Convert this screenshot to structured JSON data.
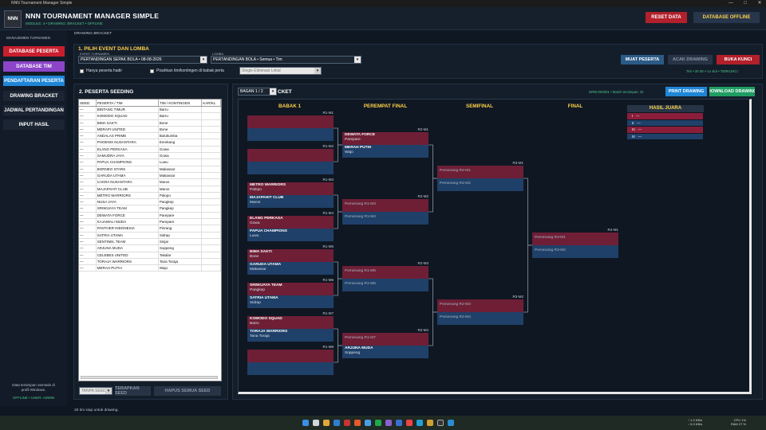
{
  "window": {
    "title": "NNN Tournament Manager Simple",
    "min": "—",
    "max": "□",
    "close": "✕"
  },
  "app": {
    "logo": "NNN",
    "title": "NNN TOURNAMENT MANAGER SIMPLE",
    "subtitle": "MODULE: 4 • DRAWING: BRACKET • OFFLINE",
    "reset_label": "RESET DATA",
    "db_label": "DATABASE OFFLINE"
  },
  "sidebar": {
    "heading": "MANAJEMEN TURNAMEN",
    "items": [
      {
        "label": "DATABASE PESERTA",
        "color": "#c81f2e"
      },
      {
        "label": "DATABASE TIM",
        "color": "#8c45c8"
      },
      {
        "label": "PENDAFTARAN PESERTA",
        "color": "#1f86d6"
      },
      {
        "label": "DRAWING  BRACKET",
        "color": "#1c2533"
      },
      {
        "label": "JADWAL PERTANDINGAN",
        "color": "#1c2533"
      },
      {
        "label": "INPUT HASIL",
        "color": "#1c2533"
      }
    ],
    "footer_line1": "Data tersimpan otomatis di",
    "footer_line2": "profil Windows.",
    "footer_status": "OFFLINE • USER: ADMIN"
  },
  "breadcrumb": "DRAWING  BRACKET",
  "event_panel": {
    "title": "1. PILIH EVENT DAN LOMBA",
    "event_label": "EVENT TURNAMEN",
    "event_value": "PERTANDINGAN SEPAK BOLA • 08-08-2026",
    "lomba_label": "LOMBA",
    "lomba_value": "PERTANDINGAN BOLA • Semua • Tim",
    "chk_hadir": "Hanya peserta hadir",
    "chk_pisahkan": "Pisahkan tim/kontingen di babak perta",
    "mode_value": "Single Eliminasi Lokal",
    "btn_muat": "MUAT PESERTA",
    "btn_acak": "ACAK DRAWING",
    "btn_kunci": "BUKA KUNCI",
    "info": "Tim • 25 tim • 1x slot • TERKUNCI"
  },
  "seeding": {
    "title": "2. PESERTA   SEEDING",
    "headers": [
      "SEED",
      "PESERTA / TIM",
      "TIM / KONTINGEN",
      "KAR/KL"
    ],
    "rows": [
      [
        "—",
        "BINTANG TIMUR",
        "Barru"
      ],
      [
        "—",
        "KOMODO SQUAD",
        "Barru"
      ],
      [
        "—",
        "BIMA SAKTI",
        "Bone"
      ],
      [
        "—",
        "MERAPI UNITED",
        "Bone"
      ],
      [
        "—",
        "ANDALAS PRIME",
        "Bulukumba"
      ],
      [
        "—",
        "PHOENIX NUSANTARA",
        "Enrekang"
      ],
      [
        "—",
        "ELANG PERKASA",
        "Gowa"
      ],
      [
        "—",
        "SAMUDRA JAYA",
        "Gowa"
      ],
      [
        "—",
        "PAPUA CHAMPIONS",
        "Luwu"
      ],
      [
        "—",
        "BORNEO STARS",
        "Makassar"
      ],
      [
        "—",
        "GARUDA UTAMA",
        "Makassar"
      ],
      [
        "—",
        "CAKRA NUSANTARA",
        "Maros"
      ],
      [
        "—",
        "MAJAPAHIT CLUB",
        "Maros"
      ],
      [
        "—",
        "METRO WARRIORS",
        "Palopo"
      ],
      [
        "—",
        "NUSA JAYA",
        "Pangkep"
      ],
      [
        "—",
        "SRIWIJAYA TEAM",
        "Pangkep"
      ],
      [
        "—",
        "DEWATA FORCE",
        "Parepare"
      ],
      [
        "—",
        "KAJAWALI MUDA",
        "Parepare"
      ],
      [
        "—",
        "PANTHER INDONESIA",
        "Pinrang"
      ],
      [
        "—",
        "SATRIA UTAMA",
        "Sidrap"
      ],
      [
        "—",
        "SENTINEL TEAM",
        "Sinjai"
      ],
      [
        "—",
        "ARJUNA MUDA",
        "Soppeng"
      ],
      [
        "—",
        "CELEBES UNITED",
        "Takalar"
      ],
      [
        "—",
        "TORAJA WARRIORS",
        "Tana Toraja"
      ],
      [
        "—",
        "MERAH PUTIH",
        "Wajo"
      ]
    ],
    "seed_select": "TANPA SEED",
    "btn_terapkan": "TERAPKAN SEED",
    "btn_hapus": "HAPUS SEMUA SEED"
  },
  "bracket": {
    "page_select": "BAGAN 1 / 2",
    "title_tail": "CKET",
    "info": "DRW-000001 • Match tersimpan: 31",
    "btn_print": "PRINT DRAWING",
    "btn_download": "DOWNLOAD DRAWING",
    "btn_terkunci": "DRAWING TERKUNCI",
    "rounds": [
      "BABAK 1",
      "PEREMPAT FINAL",
      "SEMIFINAL",
      "FINAL"
    ],
    "r1": [
      {
        "id": "R1-M1",
        "a": "",
        "ac": "",
        "b": "",
        "bc": ""
      },
      {
        "id": "R1-M2",
        "a": "",
        "ac": "",
        "b": "",
        "bc": ""
      },
      {
        "id": "R1-M3",
        "a": "METRO WARRIORS",
        "ac": "Palopo",
        "b": "MAJAPAHIT CLUB",
        "bc": "Maros"
      },
      {
        "id": "R1-M4",
        "a": "ELANG PERKASA",
        "ac": "Gowa",
        "b": "PAPUA CHAMPIONS",
        "bc": "Luwu"
      },
      {
        "id": "R1-M5",
        "a": "BIMA SAKTI",
        "ac": "Bone",
        "b": "GARUDA UTAMA",
        "bc": "Makassar"
      },
      {
        "id": "R1-M6",
        "a": "SRIWIJAYA TEAM",
        "ac": "Pangkep",
        "b": "SATRIA UTAMA",
        "bc": "Sidrap"
      },
      {
        "id": "R1-M7",
        "a": "KOMODO SQUAD",
        "ac": "Barru",
        "b": "TORAJA WARRIORS",
        "bc": "Tana Toraja"
      },
      {
        "id": "R1-M8",
        "a": "",
        "ac": "",
        "b": "",
        "bc": ""
      }
    ],
    "r2": [
      {
        "id": "R2-M1",
        "a": "DEWATA FORCE",
        "ac": "Parepare",
        "b": "MERAH PUTIH",
        "bc": "Wajo"
      },
      {
        "id": "R2-M2",
        "a": "Pemenang R1-M3",
        "b": "Pemenang R1-M4"
      },
      {
        "id": "R2-M3",
        "a": "Pemenang R1-M5",
        "b": "Pemenang R1-M6"
      },
      {
        "id": "R2-M4",
        "a": "Pemenang R1-M7",
        "b": "ARJUNA MUDA",
        "bc": "Soppeng"
      }
    ],
    "r3": [
      {
        "id": "R3-M1",
        "a": "Pemenang R2-M1",
        "b": "Pemenang R2-M2"
      },
      {
        "id": "R3-M2",
        "a": "Pemenang R2-M3",
        "b": "Pemenang R2-M4"
      }
    ],
    "r4": [
      {
        "id": "R4-M1",
        "a": "Pemenang R3-M1",
        "b": "Pemenang R3-M2"
      }
    ],
    "hasil": {
      "title": "HASIL JUARA",
      "rows": [
        {
          "rank": "I",
          "val": "—",
          "color": "#8a1e3a"
        },
        {
          "rank": "II",
          "val": "—",
          "color": "#1f4068"
        },
        {
          "rank": "III",
          "val": "—",
          "color": "#8a1e3a"
        },
        {
          "rank": "III",
          "val": "—",
          "color": "#1f4068"
        }
      ]
    }
  },
  "status": "25 tim siap untuk drawing.",
  "taskbar": {
    "net1": "↑ 1.0 KB/s",
    "net2": "↓ 5.3 KB/s",
    "time": "CPU 1%",
    "date": "RAM 27 %"
  },
  "colors": {
    "accent_yellow": "#ffd24a",
    "red": "#b1202b",
    "slot_red": "#6e1f36",
    "slot_blue": "#1f4068"
  }
}
